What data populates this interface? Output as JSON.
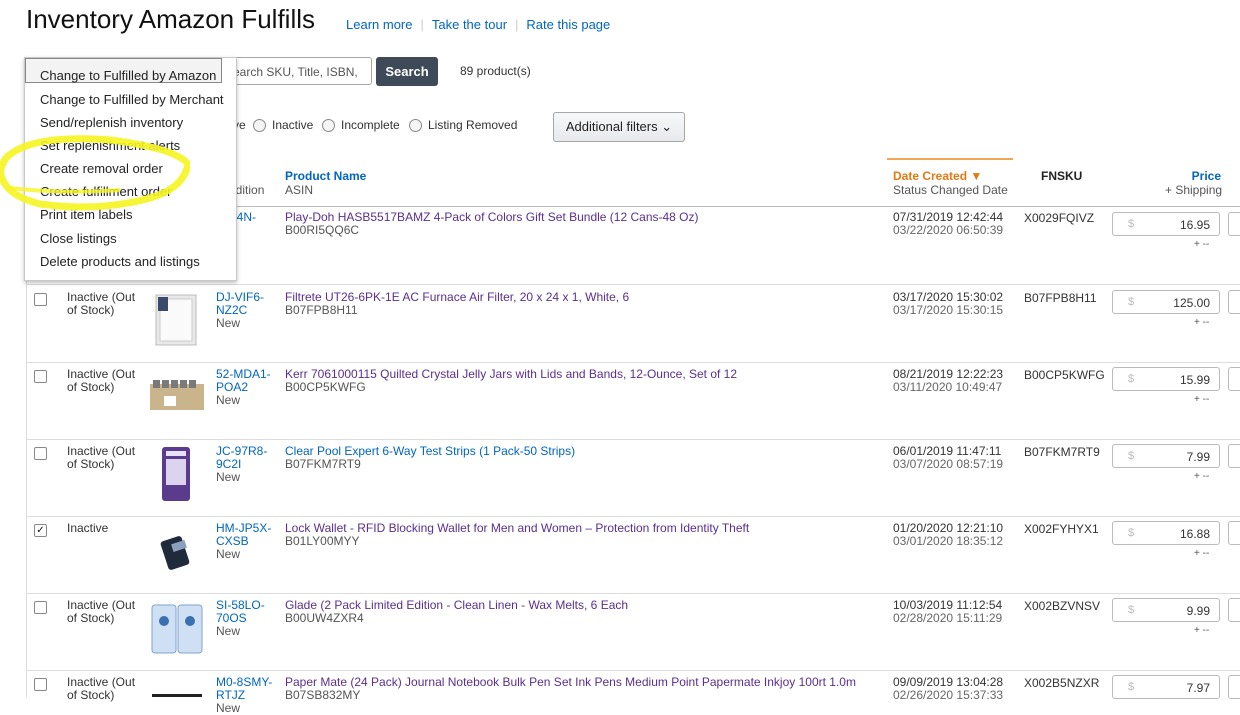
{
  "header": {
    "title": "Inventory Amazon Fulfills",
    "links": [
      "Learn more",
      "Take the tour",
      "Rate this page"
    ]
  },
  "search": {
    "placeholder": "Search SKU, Title, ISBN,",
    "visible_text": "earch SKU, Title, ISBN,",
    "button_label": "Search",
    "product_count": "89 product(s)"
  },
  "filters": {
    "partial_label": "ve",
    "options": [
      "Inactive",
      "Incomplete",
      "Listing Removed"
    ],
    "additional_label": "Additional filters"
  },
  "action_menu": {
    "items": [
      "Change to Fulfilled by Amazon",
      "Change to Fulfilled by Merchant",
      "Send/replenish inventory",
      "Set replenishment alerts",
      "Create removal order",
      "Create fulfillment order",
      "Print item labels",
      "Close listings",
      "Delete products and listings"
    ]
  },
  "table": {
    "headers": {
      "sku_partial": "U",
      "sku_sub_partial": "ndition",
      "product": "Product Name",
      "product_sub": "ASIN",
      "date": "Date Created",
      "date_sub": "Status Changed Date",
      "fnsku": "FNSKU",
      "price": "Price",
      "price_sub": "+ Shipping"
    },
    "first_row": {
      "sku_partial_1": "-TQ4N-",
      "sku_partial_2": "L",
      "cond_partial": "w",
      "name": "Play-Doh HASB5517BAMZ 4-Pack of Colors Gift Set Bundle (12 Cans-48 Oz)",
      "asin": "B00RI5QQ6C",
      "date_created": "07/31/2019 12:42:44",
      "status_changed": "03/22/2020 06:50:39",
      "fnsku": "X0029FQIVZ",
      "price": "16.95"
    },
    "rows": [
      {
        "checked": false,
        "status": "Inactive (Out of Stock)",
        "sku": "DJ-VIF6-NZ2C",
        "condition": "New",
        "name": "Filtrete UT26-6PK-1E AC Furnace Air Filter, 20 x 24 x 1, White, 6",
        "asin": "B07FPB8H11",
        "date_created": "03/17/2020 15:30:02",
        "status_changed": "03/17/2020 15:30:15",
        "fnsku": "B07FPB8H11",
        "price": "125.00"
      },
      {
        "checked": false,
        "status": "Inactive (Out of Stock)",
        "sku": "52-MDA1-POA2",
        "condition": "New",
        "name": "Kerr 7061000115 Quilted Crystal Jelly Jars with Lids and Bands, 12-Ounce, Set of 12",
        "asin": "B00CP5KWFG",
        "date_created": "08/21/2019 12:22:23",
        "status_changed": "03/11/2020 10:49:47",
        "fnsku": "B00CP5KWFG",
        "price": "15.99"
      },
      {
        "checked": false,
        "status": "Inactive (Out of Stock)",
        "sku": "JC-97R8-9C2I",
        "condition": "New",
        "name": "Clear Pool Expert 6-Way Test Strips (1 Pack-50 Strips)",
        "asin": "B07FKM7RT9",
        "date_created": "06/01/2019 11:47:11",
        "status_changed": "03/07/2020 08:57:19",
        "fnsku": "B07FKM7RT9",
        "price": "7.99"
      },
      {
        "checked": true,
        "status": "Inactive",
        "sku": "HM-JP5X-CXSB",
        "condition": "New",
        "name": "Lock Wallet - RFID Blocking Wallet for Men and Women – Protection from Identity Theft",
        "asin": "B01LY00MYY",
        "date_created": "01/20/2020 12:21:10",
        "status_changed": "03/01/2020 18:35:12",
        "fnsku": "X002FYHYX1",
        "price": "16.88"
      },
      {
        "checked": false,
        "status": "Inactive (Out of Stock)",
        "sku": "SI-58LO-70OS",
        "condition": "New",
        "name": "Glade (2 Pack Limited Edition - Clean Linen - Wax Melts, 6 Each",
        "asin": "B00UW4ZXR4",
        "date_created": "10/03/2019 11:12:54",
        "status_changed": "02/28/2020 15:11:29",
        "fnsku": "X002BZVNSV",
        "price": "9.99"
      },
      {
        "checked": false,
        "status": "Inactive (Out of Stock)",
        "sku": "M0-8SMY-RTJZ",
        "condition": "New",
        "name": "Paper Mate (24 Pack) Journal Notebook Bulk Pen Set Ink Pens Medium Point Papermate Inkjoy 100rt 1.0m",
        "asin": "B07SB832MY",
        "date_created": "09/09/2019 13:04:28",
        "status_changed": "02/26/2020 15:37:33",
        "fnsku": "X002B5NZXR",
        "price": "7.97"
      }
    ],
    "currency_symbol": "$",
    "price_adjust": "+ --"
  },
  "colors": {
    "link": "#0066c0",
    "product_name": "#5a2f8f",
    "search_button": "#3e4a57",
    "sort_accent": "#f0a657",
    "highlighter": "#f5f520"
  }
}
